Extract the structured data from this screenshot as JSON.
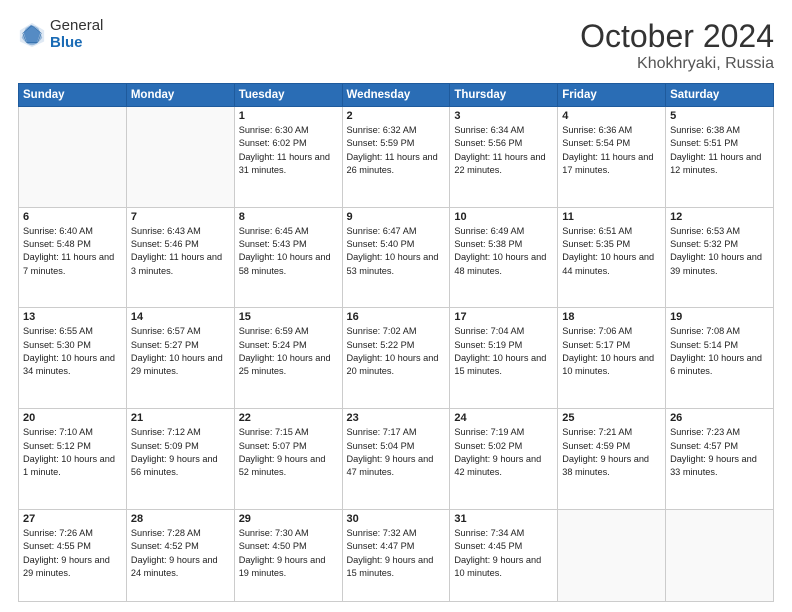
{
  "header": {
    "logo_general": "General",
    "logo_blue": "Blue",
    "title": "October 2024",
    "location": "Khokhryaki, Russia"
  },
  "weekdays": [
    "Sunday",
    "Monday",
    "Tuesday",
    "Wednesday",
    "Thursday",
    "Friday",
    "Saturday"
  ],
  "weeks": [
    [
      {
        "day": "",
        "content": ""
      },
      {
        "day": "",
        "content": ""
      },
      {
        "day": "1",
        "content": "Sunrise: 6:30 AM\nSunset: 6:02 PM\nDaylight: 11 hours and 31 minutes."
      },
      {
        "day": "2",
        "content": "Sunrise: 6:32 AM\nSunset: 5:59 PM\nDaylight: 11 hours and 26 minutes."
      },
      {
        "day": "3",
        "content": "Sunrise: 6:34 AM\nSunset: 5:56 PM\nDaylight: 11 hours and 22 minutes."
      },
      {
        "day": "4",
        "content": "Sunrise: 6:36 AM\nSunset: 5:54 PM\nDaylight: 11 hours and 17 minutes."
      },
      {
        "day": "5",
        "content": "Sunrise: 6:38 AM\nSunset: 5:51 PM\nDaylight: 11 hours and 12 minutes."
      }
    ],
    [
      {
        "day": "6",
        "content": "Sunrise: 6:40 AM\nSunset: 5:48 PM\nDaylight: 11 hours and 7 minutes."
      },
      {
        "day": "7",
        "content": "Sunrise: 6:43 AM\nSunset: 5:46 PM\nDaylight: 11 hours and 3 minutes."
      },
      {
        "day": "8",
        "content": "Sunrise: 6:45 AM\nSunset: 5:43 PM\nDaylight: 10 hours and 58 minutes."
      },
      {
        "day": "9",
        "content": "Sunrise: 6:47 AM\nSunset: 5:40 PM\nDaylight: 10 hours and 53 minutes."
      },
      {
        "day": "10",
        "content": "Sunrise: 6:49 AM\nSunset: 5:38 PM\nDaylight: 10 hours and 48 minutes."
      },
      {
        "day": "11",
        "content": "Sunrise: 6:51 AM\nSunset: 5:35 PM\nDaylight: 10 hours and 44 minutes."
      },
      {
        "day": "12",
        "content": "Sunrise: 6:53 AM\nSunset: 5:32 PM\nDaylight: 10 hours and 39 minutes."
      }
    ],
    [
      {
        "day": "13",
        "content": "Sunrise: 6:55 AM\nSunset: 5:30 PM\nDaylight: 10 hours and 34 minutes."
      },
      {
        "day": "14",
        "content": "Sunrise: 6:57 AM\nSunset: 5:27 PM\nDaylight: 10 hours and 29 minutes."
      },
      {
        "day": "15",
        "content": "Sunrise: 6:59 AM\nSunset: 5:24 PM\nDaylight: 10 hours and 25 minutes."
      },
      {
        "day": "16",
        "content": "Sunrise: 7:02 AM\nSunset: 5:22 PM\nDaylight: 10 hours and 20 minutes."
      },
      {
        "day": "17",
        "content": "Sunrise: 7:04 AM\nSunset: 5:19 PM\nDaylight: 10 hours and 15 minutes."
      },
      {
        "day": "18",
        "content": "Sunrise: 7:06 AM\nSunset: 5:17 PM\nDaylight: 10 hours and 10 minutes."
      },
      {
        "day": "19",
        "content": "Sunrise: 7:08 AM\nSunset: 5:14 PM\nDaylight: 10 hours and 6 minutes."
      }
    ],
    [
      {
        "day": "20",
        "content": "Sunrise: 7:10 AM\nSunset: 5:12 PM\nDaylight: 10 hours and 1 minute."
      },
      {
        "day": "21",
        "content": "Sunrise: 7:12 AM\nSunset: 5:09 PM\nDaylight: 9 hours and 56 minutes."
      },
      {
        "day": "22",
        "content": "Sunrise: 7:15 AM\nSunset: 5:07 PM\nDaylight: 9 hours and 52 minutes."
      },
      {
        "day": "23",
        "content": "Sunrise: 7:17 AM\nSunset: 5:04 PM\nDaylight: 9 hours and 47 minutes."
      },
      {
        "day": "24",
        "content": "Sunrise: 7:19 AM\nSunset: 5:02 PM\nDaylight: 9 hours and 42 minutes."
      },
      {
        "day": "25",
        "content": "Sunrise: 7:21 AM\nSunset: 4:59 PM\nDaylight: 9 hours and 38 minutes."
      },
      {
        "day": "26",
        "content": "Sunrise: 7:23 AM\nSunset: 4:57 PM\nDaylight: 9 hours and 33 minutes."
      }
    ],
    [
      {
        "day": "27",
        "content": "Sunrise: 7:26 AM\nSunset: 4:55 PM\nDaylight: 9 hours and 29 minutes."
      },
      {
        "day": "28",
        "content": "Sunrise: 7:28 AM\nSunset: 4:52 PM\nDaylight: 9 hours and 24 minutes."
      },
      {
        "day": "29",
        "content": "Sunrise: 7:30 AM\nSunset: 4:50 PM\nDaylight: 9 hours and 19 minutes."
      },
      {
        "day": "30",
        "content": "Sunrise: 7:32 AM\nSunset: 4:47 PM\nDaylight: 9 hours and 15 minutes."
      },
      {
        "day": "31",
        "content": "Sunrise: 7:34 AM\nSunset: 4:45 PM\nDaylight: 9 hours and 10 minutes."
      },
      {
        "day": "",
        "content": ""
      },
      {
        "day": "",
        "content": ""
      }
    ]
  ]
}
